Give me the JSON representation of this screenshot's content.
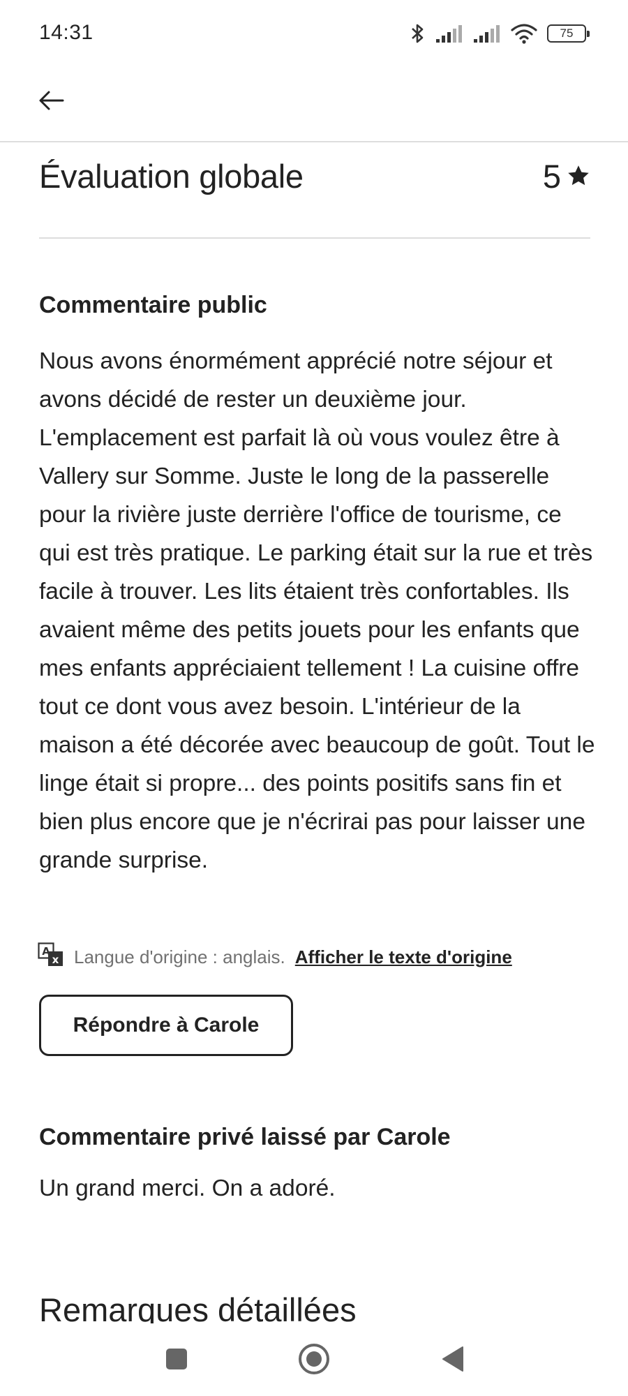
{
  "status_bar": {
    "time": "14:31",
    "battery": "75"
  },
  "review": {
    "overall_title": "Évaluation globale",
    "overall_rating": "5",
    "public_heading": "Commentaire public",
    "public_text": "Nous avons énormément apprécié notre séjour et avons décidé de rester un deuxième jour. L'emplacement est parfait là où vous voulez être à Vallery sur Somme. Juste le long de la passerelle pour la rivière juste derrière l'office de tourisme, ce qui est très pratique. Le parking était sur la rue et très facile à trouver. Les lits étaient très confortables. Ils avaient même des petits jouets pour les enfants que mes enfants appréciaient tellement ! La cuisine offre tout ce dont vous avez besoin. L'intérieur de la maison a été décorée avec beaucoup de goût. Tout le linge était si propre... des points positifs sans fin et bien plus encore que je n'écrirai pas pour laisser une grande surprise.",
    "original_language": "Langue d'origine : anglais.",
    "show_original_link": "Afficher le texte d'origine",
    "reply_button": "Répondre à Carole",
    "private_heading": "Commentaire privé laissé par Carole",
    "private_text": "Un grand merci. On a adoré.",
    "detailed_heading": "Remarques détaillées"
  }
}
